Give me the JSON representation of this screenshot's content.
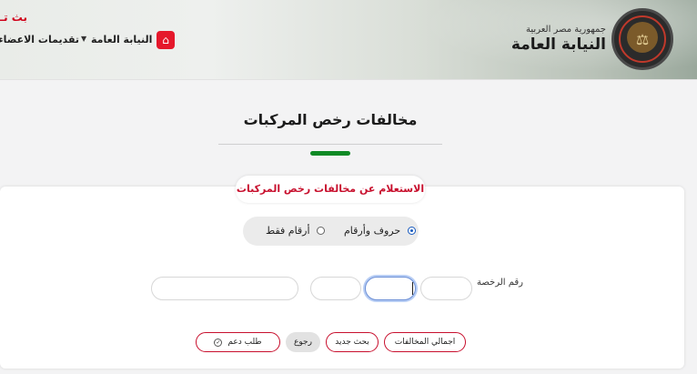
{
  "header": {
    "brand_sub": "جمهورية مصر العربية",
    "brand_title": "النيابة العامة",
    "nav": {
      "home_icon": "home-icon",
      "niyaba_label": "النيابة العامة",
      "members_label": "تقديمات الاعضاء",
      "live_text": "بث تـ"
    }
  },
  "page": {
    "title": "مخالفات رخص المركبات"
  },
  "form": {
    "card_title": "الاستعلام عن مخالفات رخص المركبات",
    "radio_options": [
      {
        "label": "حروف وأرقام",
        "selected": true
      },
      {
        "label": "أرقام فقط",
        "selected": false
      }
    ],
    "license_label": "رقم الرخصة",
    "buttons": {
      "total": "اجمالي المخالفات",
      "new_search": "بحث جديد",
      "back": "رجوع",
      "support": "طلب دعم"
    }
  },
  "colors": {
    "accent_red": "#c8102e",
    "accent_green": "#0f8a25",
    "radio_blue": "#1a5cbf"
  }
}
